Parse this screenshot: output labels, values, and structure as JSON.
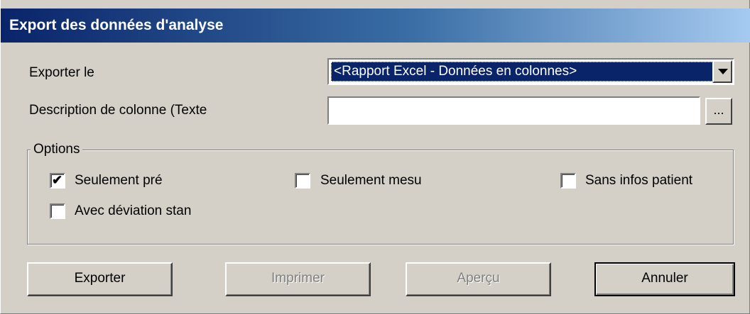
{
  "dialog": {
    "title": "Export des données d'analyse"
  },
  "export": {
    "label": "Exporter le",
    "selected": "<Rapport Excel - Données en colonnes>"
  },
  "column_description": {
    "label": "Description de colonne (Texte",
    "value": "",
    "browse_label": "..."
  },
  "options": {
    "legend": "Options",
    "checkboxes": [
      {
        "label": "Seulement pré",
        "checked": true
      },
      {
        "label": "Seulement mesu",
        "checked": false
      },
      {
        "label": "Sans infos patient",
        "checked": false
      },
      {
        "label": "Avec déviation stan",
        "checked": false
      }
    ],
    "check_glyph": "✔"
  },
  "buttons": {
    "export": "Exporter",
    "print": "Imprimer",
    "preview": "Aperçu",
    "cancel": "Annuler"
  }
}
